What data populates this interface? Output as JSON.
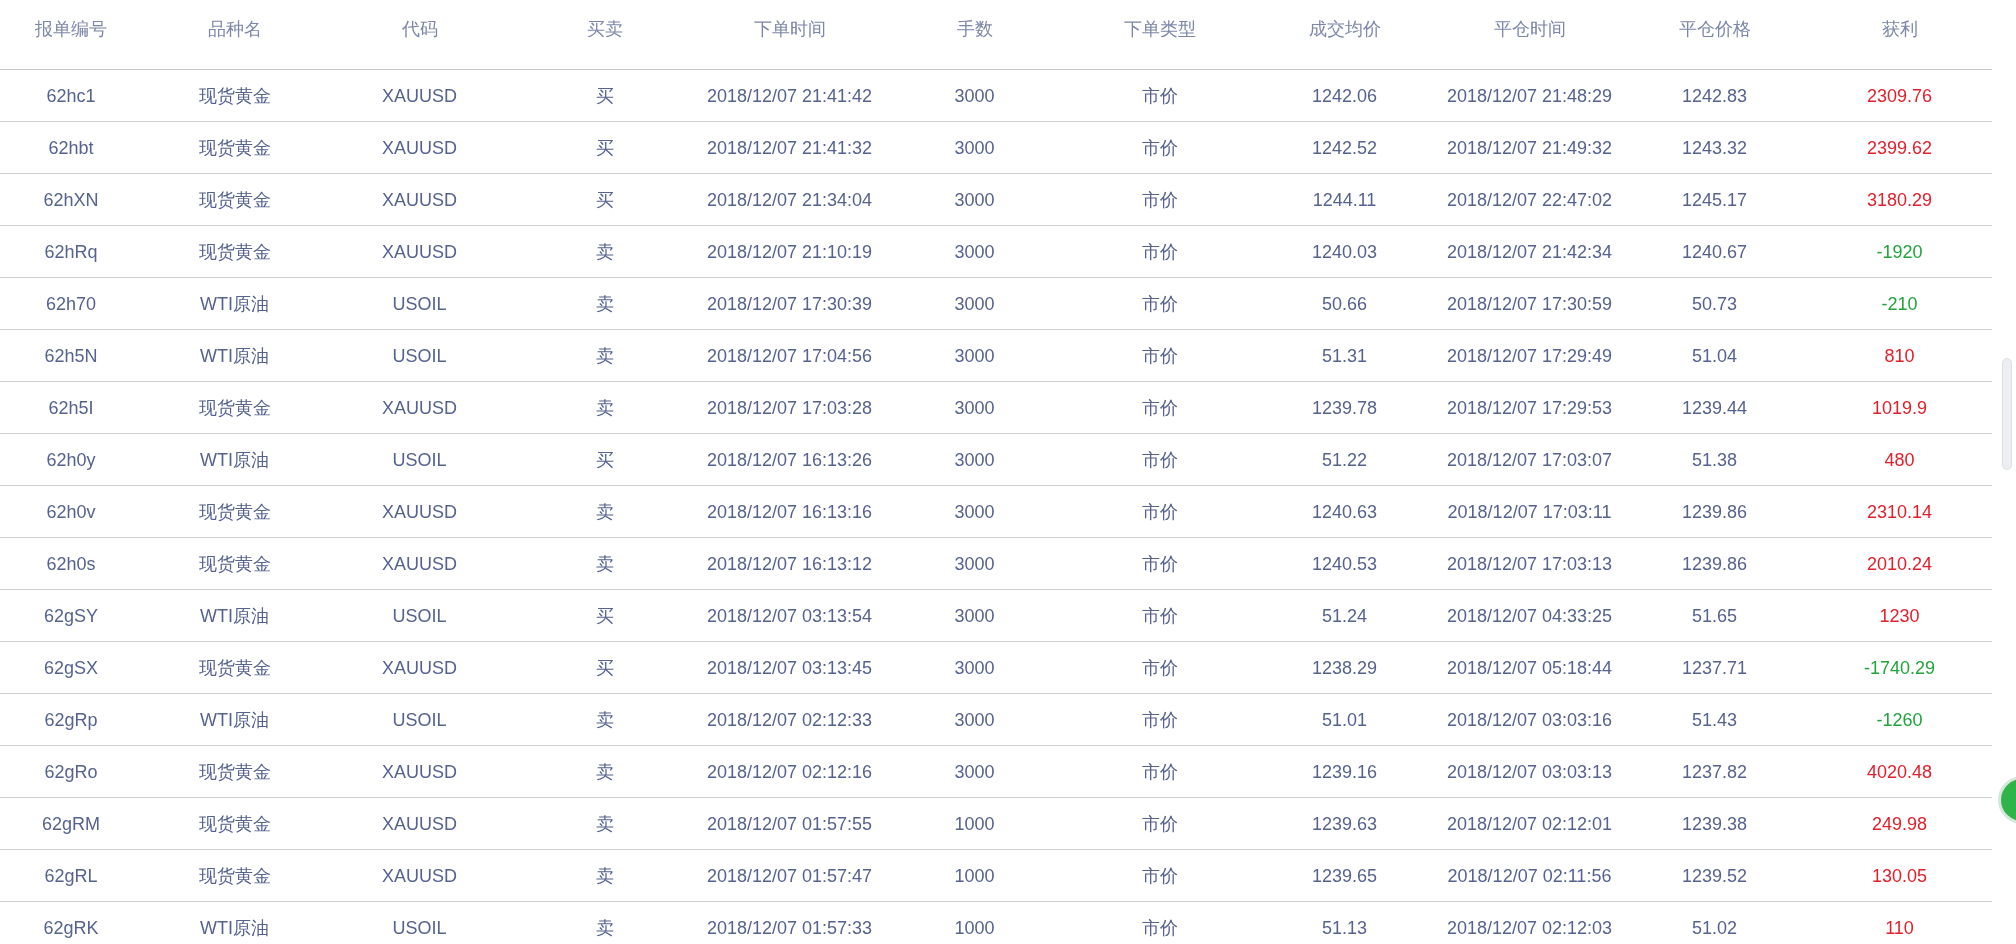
{
  "table": {
    "columns": [
      "报单编号",
      "品种名",
      "代码",
      "买卖",
      "下单时间",
      "手数",
      "下单类型",
      "成交均价",
      "平仓时间",
      "平仓价格",
      "获利"
    ],
    "rows": [
      {
        "cells": [
          "62hc1",
          "现货黄金",
          "XAUUSD",
          "买",
          "2018/12/07 21:41:42",
          "3000",
          "市价",
          "1242.06",
          "2018/12/07 21:48:29",
          "1242.83",
          "2309.76"
        ],
        "color": "#e2202c"
      },
      {
        "cells": [
          "62hbt",
          "现货黄金",
          "XAUUSD",
          "买",
          "2018/12/07 21:41:32",
          "3000",
          "市价",
          "1242.52",
          "2018/12/07 21:49:32",
          "1243.32",
          "2399.62"
        ],
        "color": "#e2202c"
      },
      {
        "cells": [
          "62hXN",
          "现货黄金",
          "XAUUSD",
          "买",
          "2018/12/07 21:34:04",
          "3000",
          "市价",
          "1244.11",
          "2018/12/07 22:47:02",
          "1245.17",
          "3180.29"
        ],
        "color": "#e2202c"
      },
      {
        "cells": [
          "62hRq",
          "现货黄金",
          "XAUUSD",
          "卖",
          "2018/12/07 21:10:19",
          "3000",
          "市价",
          "1240.03",
          "2018/12/07 21:42:34",
          "1240.67",
          "-1920"
        ],
        "color": "#22a43c"
      },
      {
        "cells": [
          "62h70",
          "WTI原油",
          "USOIL",
          "卖",
          "2018/12/07 17:30:39",
          "3000",
          "市价",
          "50.66",
          "2018/12/07 17:30:59",
          "50.73",
          "-210"
        ],
        "color": "#22a43c"
      },
      {
        "cells": [
          "62h5N",
          "WTI原油",
          "USOIL",
          "卖",
          "2018/12/07 17:04:56",
          "3000",
          "市价",
          "51.31",
          "2018/12/07 17:29:49",
          "51.04",
          "810"
        ],
        "color": "#e2202c"
      },
      {
        "cells": [
          "62h5I",
          "现货黄金",
          "XAUUSD",
          "卖",
          "2018/12/07 17:03:28",
          "3000",
          "市价",
          "1239.78",
          "2018/12/07 17:29:53",
          "1239.44",
          "1019.9"
        ],
        "color": "#e2202c"
      },
      {
        "cells": [
          "62h0y",
          "WTI原油",
          "USOIL",
          "买",
          "2018/12/07 16:13:26",
          "3000",
          "市价",
          "51.22",
          "2018/12/07 17:03:07",
          "51.38",
          "480"
        ],
        "color": "#e2202c"
      },
      {
        "cells": [
          "62h0v",
          "现货黄金",
          "XAUUSD",
          "卖",
          "2018/12/07 16:13:16",
          "3000",
          "市价",
          "1240.63",
          "2018/12/07 17:03:11",
          "1239.86",
          "2310.14"
        ],
        "color": "#e2202c"
      },
      {
        "cells": [
          "62h0s",
          "现货黄金",
          "XAUUSD",
          "卖",
          "2018/12/07 16:13:12",
          "3000",
          "市价",
          "1240.53",
          "2018/12/07 17:03:13",
          "1239.86",
          "2010.24"
        ],
        "color": "#e2202c"
      },
      {
        "cells": [
          "62gSY",
          "WTI原油",
          "USOIL",
          "买",
          "2018/12/07 03:13:54",
          "3000",
          "市价",
          "51.24",
          "2018/12/07 04:33:25",
          "51.65",
          "1230"
        ],
        "color": "#e2202c"
      },
      {
        "cells": [
          "62gSX",
          "现货黄金",
          "XAUUSD",
          "买",
          "2018/12/07 03:13:45",
          "3000",
          "市价",
          "1238.29",
          "2018/12/07 05:18:44",
          "1237.71",
          "-1740.29"
        ],
        "color": "#22a43c"
      },
      {
        "cells": [
          "62gRp",
          "WTI原油",
          "USOIL",
          "卖",
          "2018/12/07 02:12:33",
          "3000",
          "市价",
          "51.01",
          "2018/12/07 03:03:16",
          "51.43",
          "-1260"
        ],
        "color": "#22a43c"
      },
      {
        "cells": [
          "62gRo",
          "现货黄金",
          "XAUUSD",
          "卖",
          "2018/12/07 02:12:16",
          "3000",
          "市价",
          "1239.16",
          "2018/12/07 03:03:13",
          "1237.82",
          "4020.48"
        ],
        "color": "#e2202c"
      },
      {
        "cells": [
          "62gRM",
          "现货黄金",
          "XAUUSD",
          "卖",
          "2018/12/07 01:57:55",
          "1000",
          "市价",
          "1239.63",
          "2018/12/07 02:12:01",
          "1239.38",
          "249.98"
        ],
        "color": "#e2202c"
      },
      {
        "cells": [
          "62gRL",
          "现货黄金",
          "XAUUSD",
          "卖",
          "2018/12/07 01:57:47",
          "1000",
          "市价",
          "1239.65",
          "2018/12/07 02:11:56",
          "1239.52",
          "130.05"
        ],
        "color": "#e2202c"
      },
      {
        "cells": [
          "62gRK",
          "WTI原油",
          "USOIL",
          "卖",
          "2018/12/07 01:57:33",
          "1000",
          "市价",
          "51.13",
          "2018/12/07 02:12:03",
          "51.02",
          "110"
        ],
        "color": "#e2202c"
      }
    ]
  }
}
